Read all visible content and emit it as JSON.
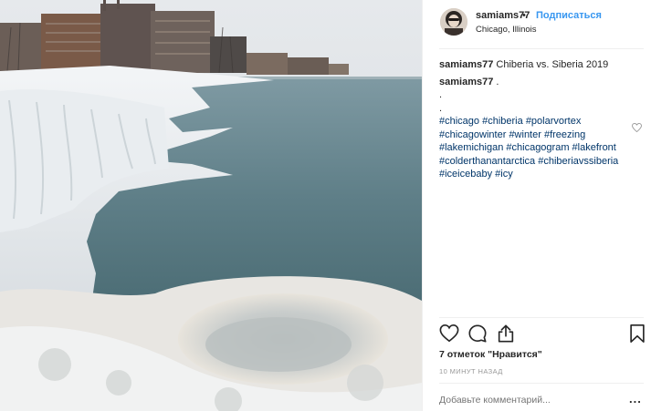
{
  "post": {
    "username": "samiams77",
    "separator": "•",
    "follow_label": "Подписаться",
    "location": "Chicago, Illinois",
    "caption_username": "samiams77",
    "caption_text": "Chiberia vs. Siberia 2019",
    "comment_username": "samiams77",
    "comment_line1": ".",
    "comment_line2": ".",
    "comment_line3": ".",
    "hashtags": [
      [
        "#chicago",
        "#chiberia",
        "#polarvortex"
      ],
      [
        "#chicagowinter",
        "#winter",
        "#freezing"
      ],
      [
        "#lakemichigan",
        "#chicagogram",
        "#lakefront"
      ],
      [
        "#colderthanantarctica",
        "#chiberiavssiberia"
      ],
      [
        "#iceicebaby",
        "#icy"
      ]
    ],
    "likes_text": "7 отметок \"Нравится\"",
    "time_text": "10 МИНУТ НАЗАД",
    "comment_placeholder": "Добавьте комментарий...",
    "more_label": "..."
  },
  "colors": {
    "link": "#003569",
    "follow": "#3897f0",
    "muted": "#999999"
  },
  "icons": [
    "heart-icon",
    "comment-icon",
    "share-icon",
    "bookmark-icon",
    "small-heart-icon"
  ]
}
